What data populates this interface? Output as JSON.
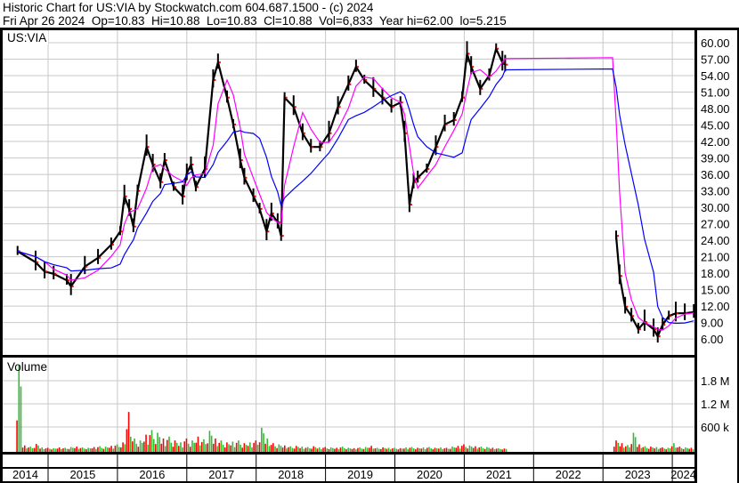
{
  "header": {
    "title": "Historic Chart for US:VIA by Stockwatch.com 604.687.1500 - (c) 2024",
    "date": "Fri Apr 26 2024",
    "open": "Op=10.83",
    "high": "Hi=10.88",
    "low": "Lo=10.83",
    "close": "Cl=10.88",
    "volume": "Vol=6,833",
    "year_high": "Year hi=62.00",
    "year_low": "lo=5.215"
  },
  "colors": {
    "price": "#000000",
    "ma_short": "#ff00ff",
    "ma_long": "#0000ff",
    "vol_up": "#33bb33",
    "vol_down": "#ff0000",
    "grid": "#c8c8c8"
  },
  "chart_data": {
    "type": "line",
    "symbol_label": "US:VIA",
    "volume_label": "Volume",
    "x_tick_labels": [
      "2014",
      "2015",
      "2016",
      "2017",
      "2018",
      "2019",
      "2020",
      "2021",
      "2022",
      "2023",
      "2024"
    ],
    "x_tick_years": [
      2014,
      2015,
      2016,
      2017,
      2018,
      2019,
      2020,
      2021,
      2022,
      2023,
      2024
    ],
    "xlim": [
      2014.33,
      2024.33
    ],
    "price_ticks": [
      60,
      57,
      54,
      51,
      48,
      45,
      42,
      39,
      36,
      33,
      30,
      27,
      24,
      21,
      18,
      15,
      12,
      9,
      6
    ],
    "price_tick_labels": [
      "60.00",
      "57.00",
      "54.00",
      "51.00",
      "48.00",
      "45.00",
      "42.00",
      "39.00",
      "36.00",
      "33.00",
      "30.00",
      "27.00",
      "24.00",
      "21.00",
      "18.00",
      "15.00",
      "12.00",
      "9.00",
      "6.00"
    ],
    "volume_ticks": [
      1800,
      1200,
      600
    ],
    "volume_tick_labels": [
      "1.8 M",
      "1.2 M",
      "600 k"
    ],
    "volume_units": "thousands",
    "price_series": [
      [
        [
          2014.56,
          22
        ],
        [
          2014.82,
          20
        ],
        [
          2014.95,
          18.3
        ],
        [
          2015.08,
          17.9
        ],
        [
          2015.27,
          16.7
        ],
        [
          2015.33,
          15.6
        ],
        [
          2015.53,
          19.2
        ],
        [
          2015.72,
          20.8
        ],
        [
          2015.91,
          23.2
        ],
        [
          2016.04,
          25.6
        ],
        [
          2016.1,
          32
        ],
        [
          2016.17,
          29.7
        ],
        [
          2016.23,
          26.5
        ],
        [
          2016.29,
          33
        ],
        [
          2016.42,
          41
        ],
        [
          2016.51,
          37.8
        ],
        [
          2016.62,
          34.6
        ],
        [
          2016.68,
          38.6
        ],
        [
          2016.81,
          33.7
        ],
        [
          2016.94,
          32
        ],
        [
          2017.0,
          36.2
        ],
        [
          2017.06,
          37.8
        ],
        [
          2017.13,
          33.7
        ],
        [
          2017.26,
          37
        ],
        [
          2017.38,
          53.2
        ],
        [
          2017.45,
          56.4
        ],
        [
          2017.58,
          50
        ],
        [
          2017.67,
          45.1
        ],
        [
          2017.77,
          38.6
        ],
        [
          2017.83,
          35.4
        ],
        [
          2017.96,
          32
        ],
        [
          2018.05,
          29.7
        ],
        [
          2018.15,
          25.6
        ],
        [
          2018.22,
          28.9
        ],
        [
          2018.31,
          27.3
        ],
        [
          2018.36,
          24.8
        ],
        [
          2018.41,
          50
        ],
        [
          2018.54,
          48.3
        ],
        [
          2018.67,
          43.5
        ],
        [
          2018.79,
          41
        ],
        [
          2018.92,
          41
        ],
        [
          2019.05,
          43.5
        ],
        [
          2019.18,
          48.3
        ],
        [
          2019.33,
          52.4
        ],
        [
          2019.44,
          55.6
        ],
        [
          2019.56,
          53.2
        ],
        [
          2019.69,
          51.6
        ],
        [
          2019.82,
          50
        ],
        [
          2019.95,
          48.3
        ],
        [
          2020.08,
          49.1
        ],
        [
          2020.14,
          43.5
        ],
        [
          2020.21,
          30.5
        ],
        [
          2020.27,
          34.6
        ],
        [
          2020.33,
          35.4
        ],
        [
          2020.46,
          37
        ],
        [
          2020.59,
          41
        ],
        [
          2020.72,
          45.1
        ],
        [
          2020.85,
          45.9
        ],
        [
          2020.97,
          50
        ],
        [
          2021.04,
          58
        ],
        [
          2021.1,
          55.6
        ],
        [
          2021.23,
          51.6
        ],
        [
          2021.36,
          54
        ],
        [
          2021.46,
          58.9
        ],
        [
          2021.55,
          56.4
        ],
        [
          2021.59,
          56
        ]
      ],
      [
        [
          2023.19,
          24.8
        ],
        [
          2023.24,
          17.5
        ],
        [
          2023.32,
          11.9
        ],
        [
          2023.41,
          10.2
        ],
        [
          2023.51,
          7.8
        ],
        [
          2023.6,
          9.1
        ],
        [
          2023.73,
          7.8
        ],
        [
          2023.79,
          6.5
        ],
        [
          2023.86,
          8.6
        ],
        [
          2023.95,
          10.2
        ],
        [
          2024.05,
          10.7
        ],
        [
          2024.18,
          10.7
        ],
        [
          2024.31,
          10.9
        ]
      ]
    ],
    "volume_series": [
      {
        "start": 2014.58,
        "step": 0.0833,
        "values": [
          2200,
          120,
          90,
          160,
          70,
          60,
          50,
          70,
          60,
          80,
          90,
          70,
          60,
          80,
          100,
          90,
          110,
          150,
          200,
          990,
          300,
          250,
          400,
          520,
          450,
          300,
          350,
          250,
          200,
          300,
          250,
          350,
          280,
          500,
          300,
          250,
          200,
          220,
          250,
          180,
          200,
          250,
          580,
          300,
          180,
          150,
          120,
          100,
          110,
          90,
          80,
          100,
          70,
          80,
          70,
          60,
          90,
          60,
          50,
          70,
          80,
          110,
          60,
          70,
          60,
          60,
          50,
          70,
          80,
          60,
          70,
          80,
          60,
          70,
          60,
          90,
          110,
          150,
          120,
          100,
          90,
          80,
          60,
          50,
          40
        ],
        "up": [
          1,
          0,
          1,
          0,
          1,
          0,
          1,
          0,
          1,
          1,
          0,
          1,
          1,
          0,
          1,
          1,
          0,
          1,
          0,
          0,
          1,
          1,
          0,
          1,
          1,
          0,
          1,
          0,
          1,
          0,
          1,
          0,
          1,
          1,
          0,
          1,
          0,
          1,
          1,
          0,
          1,
          0,
          1,
          1,
          0,
          1,
          0,
          1,
          0,
          1,
          1,
          0,
          1,
          0,
          1,
          0,
          1,
          1,
          0,
          1,
          1,
          0,
          1,
          0,
          1,
          1,
          0,
          1,
          1,
          0,
          1,
          1,
          0,
          1,
          0,
          1,
          0,
          0,
          1,
          0,
          1,
          1,
          0,
          1,
          0
        ],
        "name": "volume-2014-2021"
      },
      {
        "start": 2023.19,
        "step": 0.0833,
        "values": [
          250,
          180,
          130,
          450,
          150,
          100,
          90,
          80,
          70,
          60,
          180,
          90,
          70,
          60
        ],
        "up": [
          0,
          0,
          1,
          1,
          0,
          1,
          0,
          1,
          0,
          1,
          1,
          0,
          1,
          0
        ],
        "name": "volume-2023-2024"
      }
    ],
    "ma_short_window": 3,
    "ma_long_window": 8,
    "grid": true
  }
}
